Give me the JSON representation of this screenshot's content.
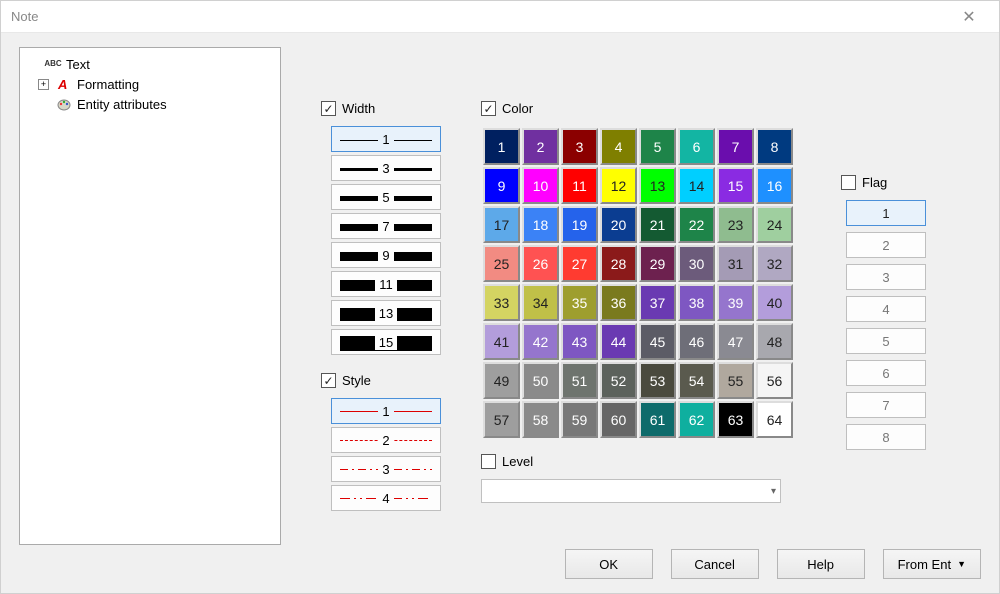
{
  "window": {
    "title": "Note"
  },
  "tree": {
    "items": [
      {
        "label": "Text"
      },
      {
        "label": "Formatting"
      },
      {
        "label": "Entity attributes"
      }
    ]
  },
  "width_section": {
    "label": "Width",
    "checked": true,
    "options": [
      "1",
      "3",
      "5",
      "7",
      "9",
      "11",
      "13",
      "15"
    ],
    "active": "1"
  },
  "style_section": {
    "label": "Style",
    "checked": true,
    "options": [
      "1",
      "2",
      "3",
      "4"
    ],
    "active": "1"
  },
  "color_section": {
    "label": "Color",
    "checked": true,
    "colors": [
      "#002060",
      "#7030A0",
      "#8B0000",
      "#7F7F00",
      "#1E8449",
      "#13B5A3",
      "#6A0DAD",
      "#003A80",
      "#0000FF",
      "#FF00FF",
      "#FF0000",
      "#FFFF00",
      "#00FF00",
      "#00CFFF",
      "#8A2BE2",
      "#1E90FF",
      "#5DA9E9",
      "#3B82F6",
      "#2563EB",
      "#0B3D91",
      "#145A32",
      "#1E8449",
      "#8FBC8F",
      "#9FCF9F",
      "#F28B82",
      "#FF5252",
      "#FF3B30",
      "#8B1A1A",
      "#6D214F",
      "#6C5B7B",
      "#A49BB5",
      "#B0A8C2",
      "#D4D462",
      "#C0C048",
      "#9E9E2E",
      "#7A7A1E",
      "#6A3AB2",
      "#7E57C2",
      "#9575CD",
      "#B39DDB",
      "#B39DDB",
      "#9575CD",
      "#7E57C2",
      "#6A3AB2",
      "#5C5C66",
      "#6E6E78",
      "#8A8A92",
      "#A8A8AE",
      "#9E9E9E",
      "#8A8A8A",
      "#6E746E",
      "#5C625C",
      "#4A4A3E",
      "#5A5A4E",
      "#B0A89E",
      "#F5F5F5",
      "#9E9E9E",
      "#8A8A8A",
      "#787878",
      "#666666",
      "#0E6B6B",
      "#0FAF9F",
      "#000000",
      "#FFFFFF"
    ]
  },
  "level_section": {
    "label": "Level",
    "checked": false,
    "value": ""
  },
  "flag_section": {
    "label": "Flag",
    "checked": false,
    "options": [
      "1",
      "2",
      "3",
      "4",
      "5",
      "6",
      "7",
      "8"
    ],
    "active": "1"
  },
  "footer": {
    "ok": "OK",
    "cancel": "Cancel",
    "help": "Help",
    "from_ent": "From Ent"
  }
}
